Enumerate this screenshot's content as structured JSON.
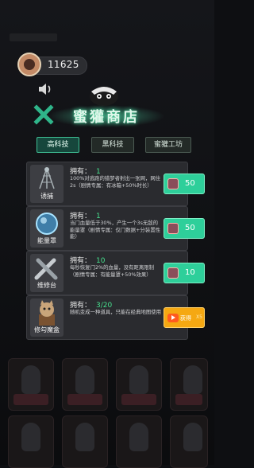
{
  "header": {
    "currency_value": "11625",
    "currency_icon": "avatar-coin-icon"
  },
  "title": "蜜獾商店",
  "tabs": [
    {
      "label": "高科技",
      "active": true
    },
    {
      "label": "黑科技",
      "active": false
    },
    {
      "label": "蜜獾工坊",
      "active": false
    }
  ],
  "items": [
    {
      "name": "诱捕",
      "owned_label": "拥有：",
      "owned": "1",
      "desc": "100%对逃跑的猎梦者射出一张网，网住2s（剧情专属：有冰箱+50%时长）",
      "price": "50",
      "icon": "trap-net-icon"
    },
    {
      "name": "能量罩",
      "owned_label": "拥有：",
      "owned": "1",
      "desc": "当门血量低于30%，产生一个3s无敌的能量罩（剧情专属：仅门数据+分装置性能）",
      "price": "50",
      "icon": "energy-shield-icon"
    },
    {
      "name": "维修台",
      "owned_label": "拥有：",
      "owned": "10",
      "desc": "每秒恢复门2%的血量，没有距离限制（剧情专属：有能量罩+50%效果）",
      "price": "10",
      "icon": "repair-wrench-icon"
    },
    {
      "name": "修勾魔盒",
      "owned_label": "拥有：",
      "owned": "3/20",
      "desc": "随机变成一种道具，只能在经典地图使用",
      "ad_label": "获得",
      "ad_count": "X5",
      "icon": "dog-box-icon"
    }
  ],
  "colors": {
    "accent_green": "#2ecf9a",
    "ad_orange": "#f5a812",
    "owned_green": "#47e08e"
  }
}
